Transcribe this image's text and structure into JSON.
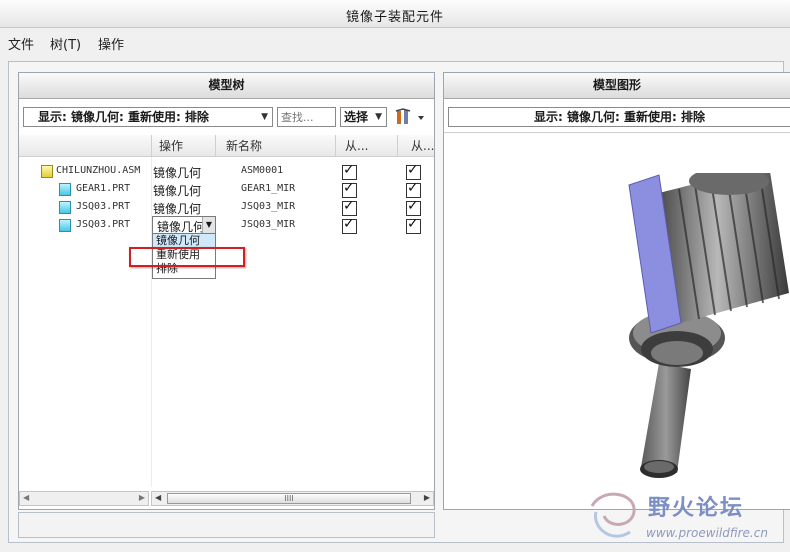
{
  "window": {
    "title": "镜像子装配元件"
  },
  "menu": [
    {
      "label": "文件"
    },
    {
      "label": "树(T)"
    },
    {
      "label": "操作"
    }
  ],
  "left_panel": {
    "title": "模型树",
    "display_combo": "显示: 镜像几何: 重新使用: 排除",
    "search_placeholder": "查找...",
    "select_label": "选择",
    "columns": [
      "操作",
      "新名称",
      "从...",
      "从..."
    ],
    "rows": [
      {
        "name": "CHILUNZHOU.ASM",
        "op": "镜像几何",
        "new_name": "ASM0001",
        "from1": true,
        "from2": true,
        "icon": "assembly-icon"
      },
      {
        "name": "GEAR1.PRT",
        "op": "镜像几何",
        "new_name": "GEAR1_MIR",
        "from1": true,
        "from2": true,
        "icon": "part-icon"
      },
      {
        "name": "JSQ03.PRT",
        "op": "镜像几何",
        "new_name": "JSQ03_MIR",
        "from1": true,
        "from2": true,
        "icon": "part-icon"
      },
      {
        "name": "JSQ03.PRT",
        "op": "镜像几何",
        "new_name": "JSQ03_MIR",
        "from1": true,
        "from2": true,
        "icon": "part-icon"
      }
    ],
    "dropdown_options": [
      "镜像几何",
      "重新使用",
      "排除"
    ],
    "hscroll_label": "IIII"
  },
  "right_panel": {
    "title": "模型图形",
    "display_combo": "显示: 镜像几何: 重新使用: 排除"
  },
  "watermark": {
    "name": "野火论坛",
    "url": "www.proewildfire.cn"
  },
  "colors": {
    "highlight_box": "#d02020",
    "selected_option": "#cfe8fb"
  }
}
